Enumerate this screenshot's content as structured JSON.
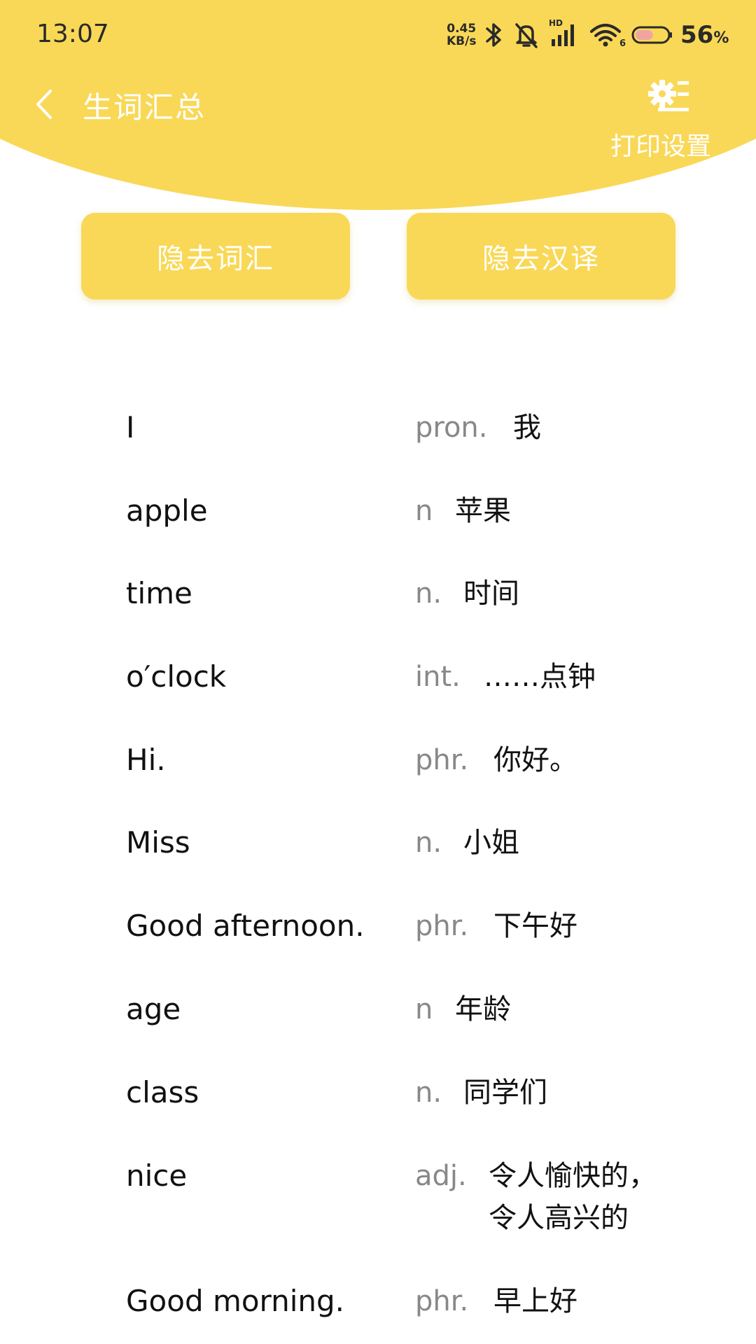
{
  "status_bar": {
    "time": "13:07",
    "net_speed_value": "0.45",
    "net_speed_unit": "KB/s",
    "signal_label": "HD",
    "wifi_label": "6",
    "battery_value": "56",
    "battery_unit": "%",
    "battery_level": 0.56
  },
  "header": {
    "title": "生词汇总",
    "print_settings_label": "打印设置"
  },
  "actions": {
    "hide_words_label": "隐去词汇",
    "hide_translation_label": "隐去汉译"
  },
  "colors": {
    "accent": "#f9d857",
    "pos_text": "#888888",
    "word_text": "#111111"
  },
  "words": [
    {
      "en": "I",
      "pos": "pron.",
      "cn": "我"
    },
    {
      "en": "apple",
      "pos": "n",
      "cn": "苹果"
    },
    {
      "en": "time",
      "pos": "n.",
      "cn": "时间"
    },
    {
      "en": "o′clock",
      "pos": "int.",
      "cn": "……点钟"
    },
    {
      "en": "Hi.",
      "pos": "phr.",
      "cn": "你好。"
    },
    {
      "en": "Miss",
      "pos": "n.",
      "cn": "小姐"
    },
    {
      "en": "Good afternoon.",
      "pos": "phr.",
      "cn": "下午好"
    },
    {
      "en": "age",
      "pos": "n",
      "cn": "年龄"
    },
    {
      "en": "class",
      "pos": "n.",
      "cn": "同学们"
    },
    {
      "en": "nice",
      "pos": "adj.",
      "cn": "令人愉快的，",
      "cn_line2": "令人高兴的"
    },
    {
      "en": "Good morning.",
      "pos": "phr.",
      "cn": "早上好"
    }
  ]
}
